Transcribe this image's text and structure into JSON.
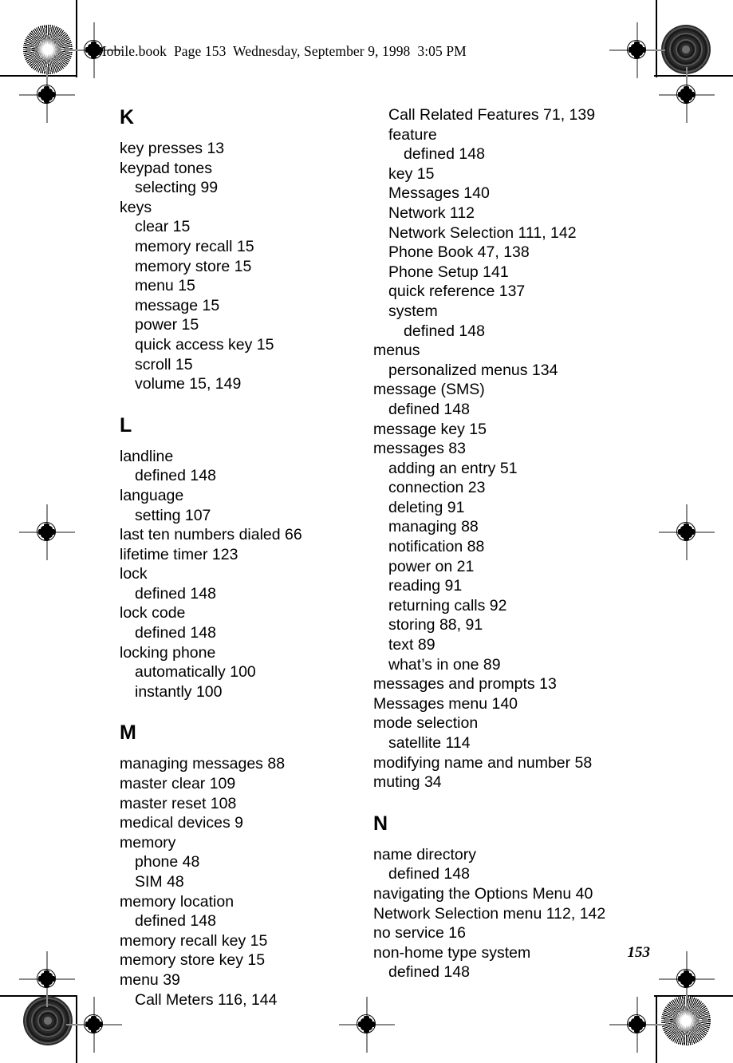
{
  "header": {
    "running_head": "Mobile.book  Page 153  Wednesday, September 9, 1998  3:05 PM"
  },
  "folio": {
    "page_number": "153"
  },
  "marks": {
    "top_left_disc": "starburst-registration-disc",
    "top_right_disc": "concentric-rings-registration-disc",
    "bottom_left_disc": "concentric-rings-registration-disc",
    "bottom_right_disc": "starburst-registration-disc",
    "crosshair": "registration-crosshair-target"
  },
  "index": {
    "columns": [
      {
        "id": "left",
        "sections": [
          {
            "letter": "K",
            "entries": [
              {
                "level": 1,
                "text": "key presses 13"
              },
              {
                "level": 1,
                "text": "keypad tones"
              },
              {
                "level": 2,
                "text": "selecting 99"
              },
              {
                "level": 1,
                "text": "keys"
              },
              {
                "level": 2,
                "text": "clear 15"
              },
              {
                "level": 2,
                "text": "memory recall 15"
              },
              {
                "level": 2,
                "text": "memory store 15"
              },
              {
                "level": 2,
                "text": "menu 15"
              },
              {
                "level": 2,
                "text": "message 15"
              },
              {
                "level": 2,
                "text": "power 15"
              },
              {
                "level": 2,
                "text": "quick access key 15"
              },
              {
                "level": 2,
                "text": "scroll 15"
              },
              {
                "level": 2,
                "text": "volume 15, 149"
              }
            ]
          },
          {
            "letter": "L",
            "entries": [
              {
                "level": 1,
                "text": "landline"
              },
              {
                "level": 2,
                "text": "defined 148"
              },
              {
                "level": 1,
                "text": "language"
              },
              {
                "level": 2,
                "text": "setting 107"
              },
              {
                "level": 1,
                "text": "last ten numbers dialed 66"
              },
              {
                "level": 1,
                "text": "lifetime timer 123"
              },
              {
                "level": 1,
                "text": "lock"
              },
              {
                "level": 2,
                "text": "defined 148"
              },
              {
                "level": 1,
                "text": "lock code"
              },
              {
                "level": 2,
                "text": "defined 148"
              },
              {
                "level": 1,
                "text": "locking phone"
              },
              {
                "level": 2,
                "text": "automatically 100"
              },
              {
                "level": 2,
                "text": "instantly 100"
              }
            ]
          },
          {
            "letter": "M",
            "entries": [
              {
                "level": 1,
                "text": "managing messages 88"
              },
              {
                "level": 1,
                "text": "master clear 109"
              },
              {
                "level": 1,
                "text": "master reset 108"
              },
              {
                "level": 1,
                "text": "medical devices 9"
              },
              {
                "level": 1,
                "text": "memory"
              },
              {
                "level": 2,
                "text": "phone 48"
              },
              {
                "level": 2,
                "text": "SIM 48"
              },
              {
                "level": 1,
                "text": "memory location"
              },
              {
                "level": 2,
                "text": "defined 148"
              },
              {
                "level": 1,
                "text": "memory recall key 15"
              },
              {
                "level": 1,
                "text": "memory store key 15"
              },
              {
                "level": 1,
                "text": "menu 39"
              },
              {
                "level": 2,
                "text": "Call Meters 116, 144"
              }
            ]
          }
        ]
      },
      {
        "id": "right",
        "sections": [
          {
            "letter": "",
            "entries": [
              {
                "level": 2,
                "text": "Call Related Features 71, 139"
              },
              {
                "level": 2,
                "text": "feature"
              },
              {
                "level": 3,
                "text": "defined 148"
              },
              {
                "level": 2,
                "text": "key 15"
              },
              {
                "level": 2,
                "text": "Messages 140"
              },
              {
                "level": 2,
                "text": "Network 112"
              },
              {
                "level": 2,
                "text": "Network Selection 111, 142"
              },
              {
                "level": 2,
                "text": "Phone Book 47, 138"
              },
              {
                "level": 2,
                "text": "Phone Setup 141"
              },
              {
                "level": 2,
                "text": "quick reference 137"
              },
              {
                "level": 2,
                "text": "system"
              },
              {
                "level": 3,
                "text": "defined 148"
              },
              {
                "level": 1,
                "text": "menus"
              },
              {
                "level": 2,
                "text": "personalized menus 134"
              },
              {
                "level": 1,
                "text": "message (SMS)"
              },
              {
                "level": 2,
                "text": "defined 148"
              },
              {
                "level": 1,
                "text": "message key 15"
              },
              {
                "level": 1,
                "text": "messages 83"
              },
              {
                "level": 2,
                "text": "adding an entry 51"
              },
              {
                "level": 2,
                "text": "connection 23"
              },
              {
                "level": 2,
                "text": "deleting 91"
              },
              {
                "level": 2,
                "text": "managing 88"
              },
              {
                "level": 2,
                "text": "notification 88"
              },
              {
                "level": 2,
                "text": "power on 21"
              },
              {
                "level": 2,
                "text": "reading 91"
              },
              {
                "level": 2,
                "text": "returning calls 92"
              },
              {
                "level": 2,
                "text": "storing 88, 91"
              },
              {
                "level": 2,
                "text": "text 89"
              },
              {
                "level": 2,
                "text": "what’s in one 89"
              },
              {
                "level": 1,
                "text": "messages and prompts 13"
              },
              {
                "level": 1,
                "text": "Messages menu 140"
              },
              {
                "level": 1,
                "text": "mode selection"
              },
              {
                "level": 2,
                "text": "satellite 114"
              },
              {
                "level": 1,
                "text": "modifying name and number 58"
              },
              {
                "level": 1,
                "text": "muting 34"
              }
            ]
          },
          {
            "letter": "N",
            "entries": [
              {
                "level": 1,
                "text": "name directory"
              },
              {
                "level": 2,
                "text": "defined 148"
              },
              {
                "level": 1,
                "text": "navigating the Options Menu 40"
              },
              {
                "level": 1,
                "text": "Network Selection menu 112, 142"
              },
              {
                "level": 1,
                "text": "no service 16"
              },
              {
                "level": 1,
                "text": "non-home type system"
              },
              {
                "level": 2,
                "text": "defined 148"
              }
            ]
          }
        ]
      }
    ]
  }
}
